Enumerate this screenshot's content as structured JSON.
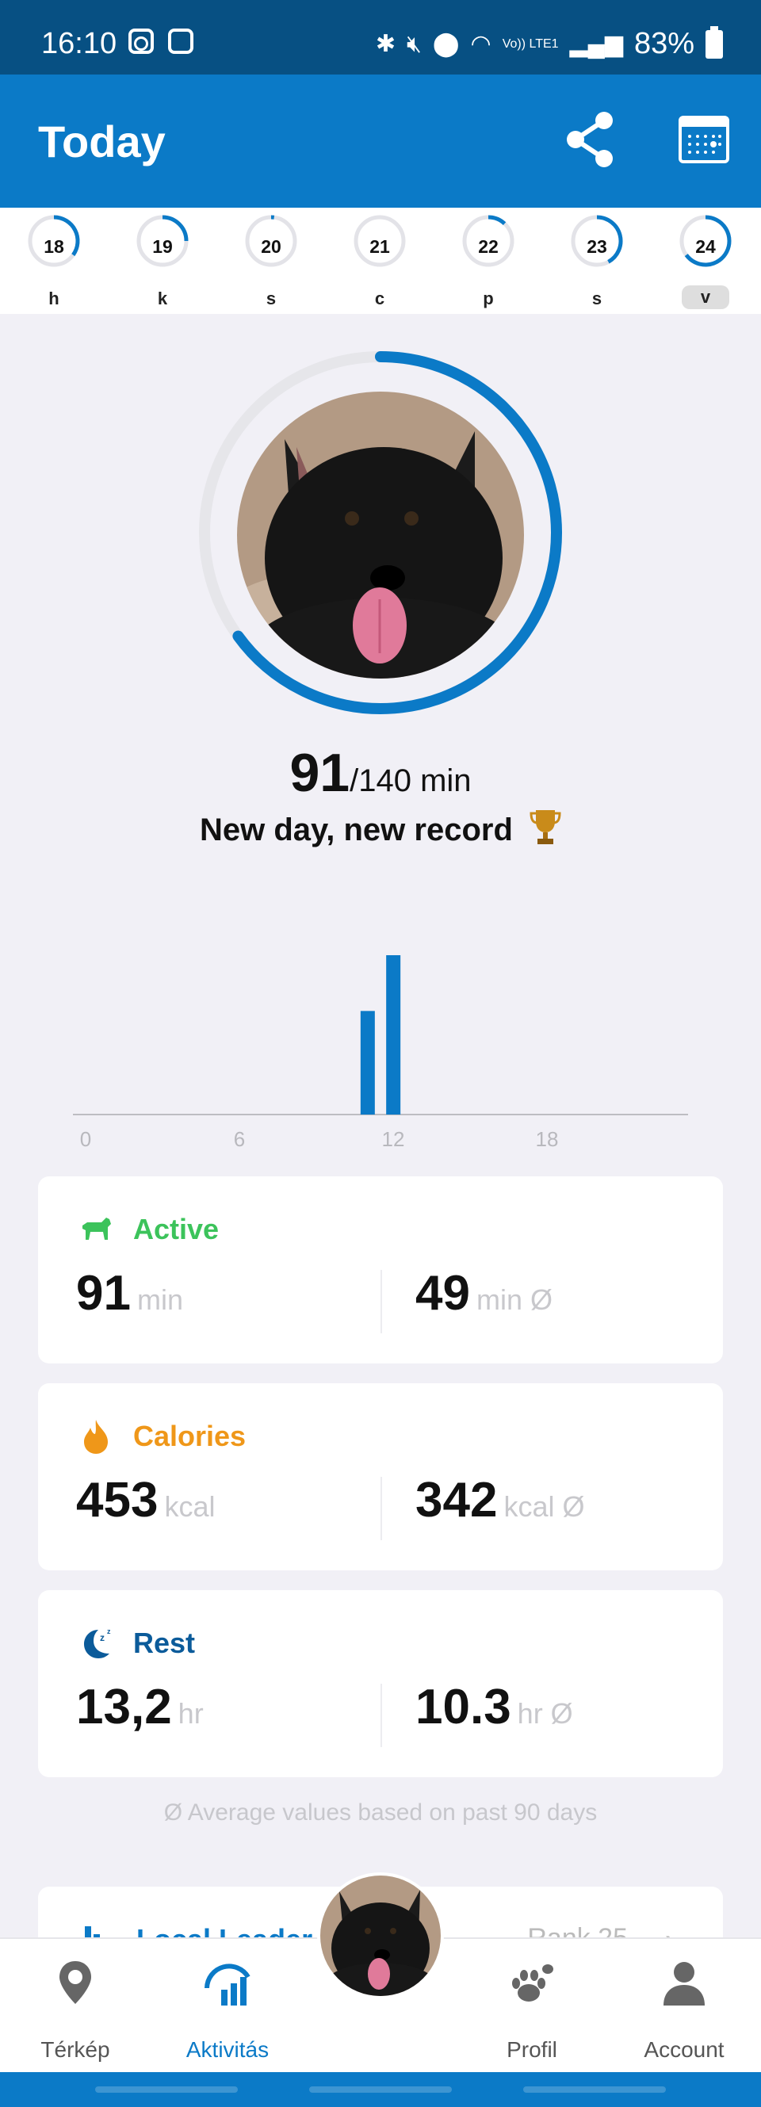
{
  "status_bar": {
    "time": "16:10",
    "battery": "83%",
    "signal_label": "Vo)) LTE1"
  },
  "app_bar": {
    "title": "Today"
  },
  "week": [
    {
      "num": "18",
      "label": "h",
      "progress": 0.35
    },
    {
      "num": "19",
      "label": "k",
      "progress": 0.25
    },
    {
      "num": "20",
      "label": "s",
      "progress": 0.02
    },
    {
      "num": "21",
      "label": "c",
      "progress": 0.0
    },
    {
      "num": "22",
      "label": "p",
      "progress": 0.12
    },
    {
      "num": "23",
      "label": "s",
      "progress": 0.42
    },
    {
      "num": "24",
      "label": "v",
      "progress": 0.65,
      "selected": true
    }
  ],
  "summary": {
    "minutes": "91",
    "goal": "/140 min",
    "progress": 0.65,
    "message": "New day, new record"
  },
  "chart_data": {
    "type": "bar",
    "x_ticks": [
      "0",
      "6",
      "12",
      "18"
    ],
    "bars": [
      {
        "hour": 11,
        "value": 65
      },
      {
        "hour": 12,
        "value": 100
      }
    ],
    "ylim": [
      0,
      100
    ],
    "colors": {
      "bar": "#0b7ac7",
      "axis": "#bdbdc2"
    }
  },
  "cards": {
    "active": {
      "title": "Active",
      "value": "91",
      "unit": "min",
      "avg_value": "49",
      "avg_unit": "min Ø"
    },
    "calories": {
      "title": "Calories",
      "value": "453",
      "unit": "kcal",
      "avg_value": "342",
      "avg_unit": "kcal Ø"
    },
    "rest": {
      "title": "Rest",
      "value": "13,2",
      "unit": "hr",
      "avg_value": "10.3",
      "avg_unit": "hr Ø"
    }
  },
  "note": "Ø Average values based on past 90 days",
  "leaderboard": {
    "title": "Local Leader",
    "rank": "Rank 25"
  },
  "nav": {
    "items": [
      {
        "label": "Térkép",
        "icon": "map-pin-icon"
      },
      {
        "label": "Aktivitás",
        "icon": "activity-icon",
        "active": true
      },
      {
        "label": "Profil",
        "icon": "paw-icon"
      },
      {
        "label": "Account",
        "icon": "person-icon"
      }
    ]
  },
  "colors": {
    "primary": "#0b7ac7",
    "status_bar": "#075083",
    "active": "#3cc35b",
    "calories": "#ef9719",
    "rest": "#0b5b9a"
  }
}
